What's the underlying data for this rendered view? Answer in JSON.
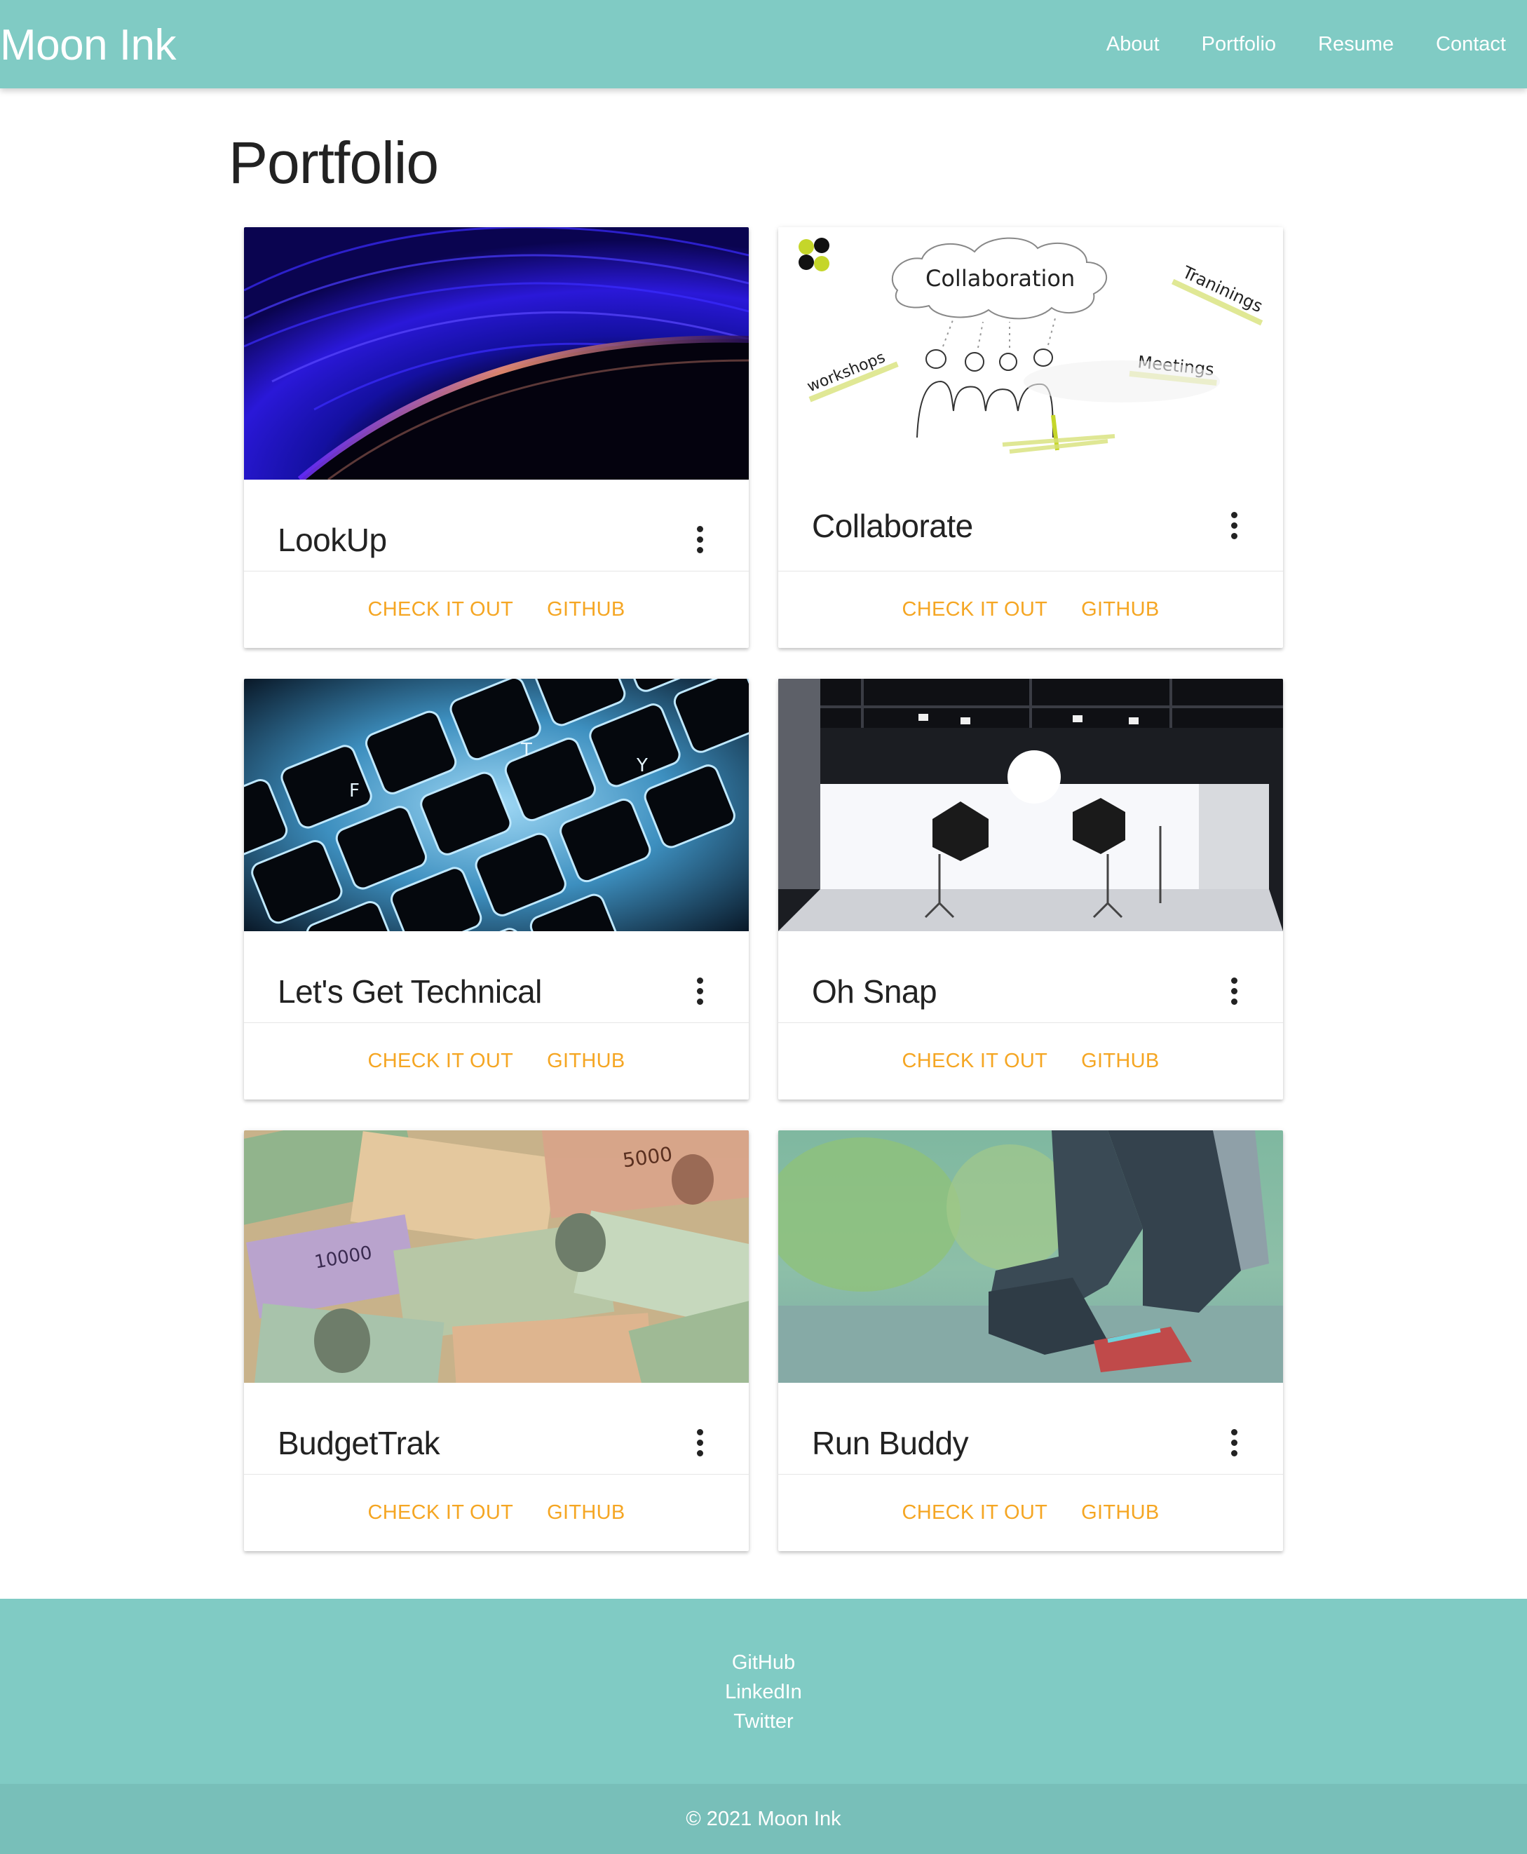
{
  "navbar": {
    "brand": "Moon Ink",
    "links": [
      "About",
      "Portfolio",
      "Resume",
      "Contact"
    ]
  },
  "page": {
    "title": "Portfolio"
  },
  "cards": [
    {
      "title": "LookUp",
      "primary_action": "Check It Out",
      "secondary_action": "GitHub",
      "image": "blue-planet-horizon"
    },
    {
      "title": "Collaborate",
      "primary_action": "Check It Out",
      "secondary_action": "GitHub",
      "image": "collaboration-sketch",
      "image_text": {
        "cloud": "Collaboration",
        "left": "workshops",
        "right_top": "Traninings",
        "right": "Meetings"
      }
    },
    {
      "title": "Let's Get Technical",
      "primary_action": "Check It Out",
      "secondary_action": "GitHub",
      "image": "backlit-keyboard",
      "image_text": {
        "keys": [
          "F",
          "T",
          "Y"
        ]
      }
    },
    {
      "title": "Oh Snap",
      "primary_action": "Check It Out",
      "secondary_action": "GitHub",
      "image": "photo-studio"
    },
    {
      "title": "BudgetTrak",
      "primary_action": "Check It Out",
      "secondary_action": "GitHub",
      "image": "banknotes",
      "image_text": {
        "notes": [
          "5000",
          "10000"
        ]
      }
    },
    {
      "title": "Run Buddy",
      "primary_action": "Check It Out",
      "secondary_action": "GitHub",
      "image": "runner-tying-shoe"
    }
  ],
  "footer": {
    "links": [
      "GitHub",
      "LinkedIn",
      "Twitter"
    ],
    "copyright": "© 2021 Moon Ink"
  },
  "colors": {
    "primary": "#80cbc4",
    "accent": "#f5a623",
    "footer_copyright": "#78bfb9"
  },
  "icons": {
    "card_menu": "more-vert-icon"
  }
}
